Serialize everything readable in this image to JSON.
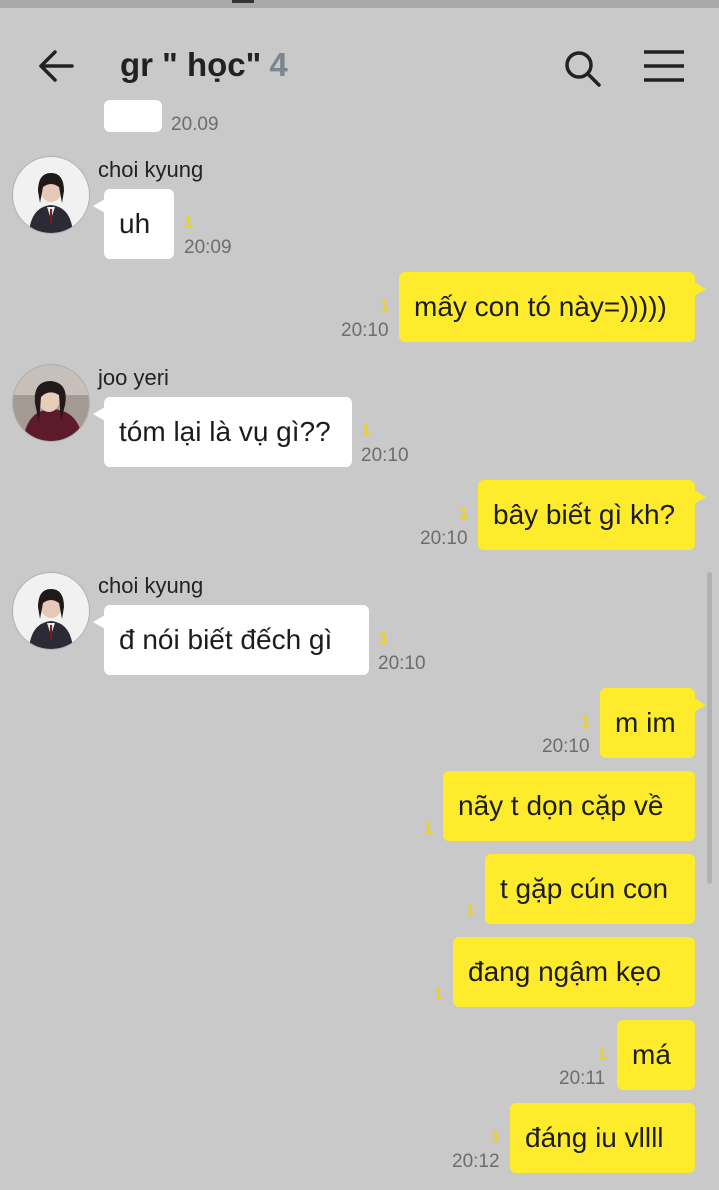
{
  "header": {
    "title": "gr \" học\"",
    "member_count": "4"
  },
  "messages": [
    {
      "time": "20.09"
    },
    {
      "sender": "choi kyung",
      "text": "uh",
      "unread": "1",
      "time": "20:09"
    },
    {
      "text": "mấy con tó này=)))))",
      "unread": "1",
      "time": "20:10"
    },
    {
      "sender": "joo yeri",
      "text": "tóm lại là vụ gì??",
      "unread": "1",
      "time": "20:10"
    },
    {
      "text": "bây biết gì kh?",
      "unread": "1",
      "time": "20:10"
    },
    {
      "sender": "choi kyung",
      "text": "đ nói biết đếch gì",
      "unread": "1",
      "time": "20:10"
    },
    {
      "text": "m im",
      "unread": "1",
      "time": "20:10"
    },
    {
      "text": "nãy t dọn cặp về",
      "unread": "1"
    },
    {
      "text": "t gặp cún con",
      "unread": "1"
    },
    {
      "text": "đang ngậm kẹo",
      "unread": "1"
    },
    {
      "text": "má",
      "unread": "1",
      "time": "20:11"
    },
    {
      "text": "đáng iu vllll",
      "unread": "1",
      "time": "20:12"
    }
  ],
  "colors": {
    "background": "#c9c9c9",
    "outgoing_bubble": "#fdeb2c",
    "incoming_bubble": "#ffffff",
    "unread_counter": "#eed21c",
    "member_count": "#7b8591"
  },
  "icons": [
    "back-arrow-icon",
    "search-icon",
    "menu-icon"
  ]
}
